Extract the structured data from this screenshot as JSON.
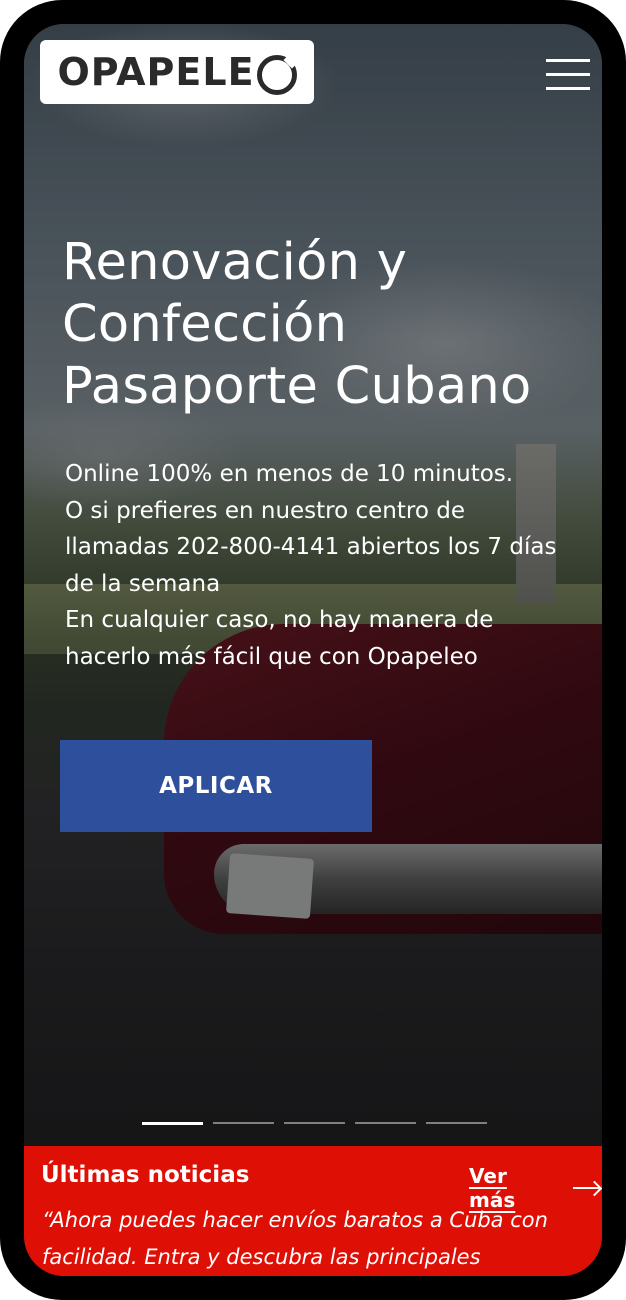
{
  "header": {
    "logo_text": "OPAPELE",
    "logo_icon": "logo-o-icon",
    "menu_icon": "hamburger-menu-icon"
  },
  "hero": {
    "title_lines": [
      "Renovación y",
      "Confección",
      "Pasaporte Cubano"
    ],
    "description_lines": [
      "Online 100% en menos de 10 minutos.",
      "O si prefieres en nuestro centro de llamadas 202-800-4141 abiertos los 7 días de la semana",
      "En cualquier caso, no hay manera de hacerlo más fácil que con Opapeleo"
    ],
    "cta_label": "APLICAR",
    "cta_color": "#2e4f9c"
  },
  "carousel": {
    "slide_count": 5,
    "active_index": 0
  },
  "news": {
    "title": "Últimas noticias",
    "more_label": "Ver más",
    "more_icon": "arrow-right-icon",
    "quote": "“Ahora puedes hacer envíos baratos a Cuba con facilidad. Entra y descubra las principales ventajas”",
    "background_color": "#de0f05"
  }
}
